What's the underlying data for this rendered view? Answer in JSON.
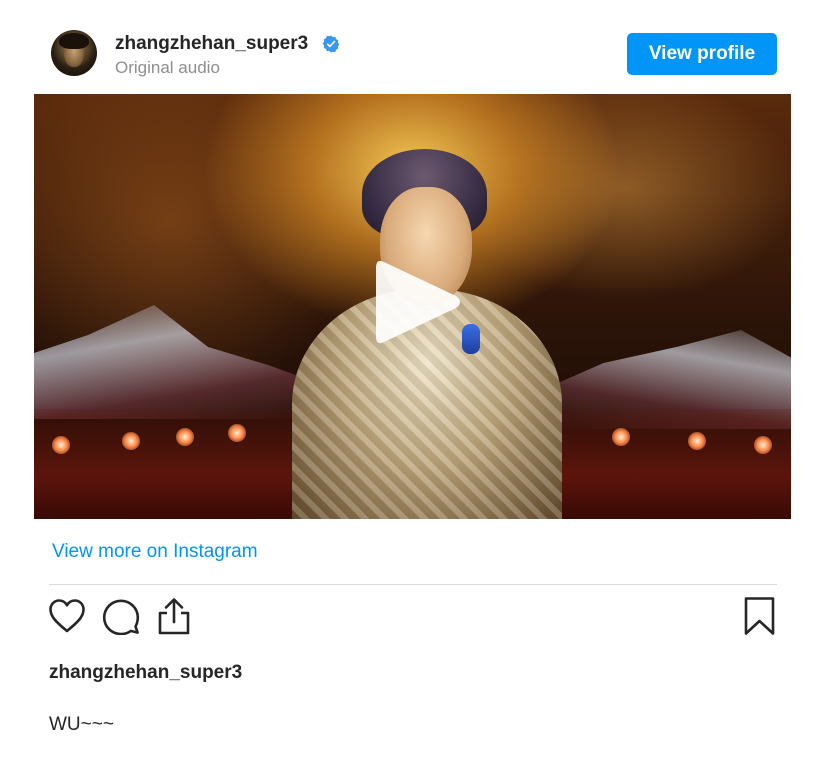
{
  "header": {
    "username": "zhangzhehan_super3",
    "subtitle": "Original audio",
    "verified": true,
    "view_profile_label": "View profile"
  },
  "media": {
    "type": "video",
    "play_icon": "play-icon"
  },
  "link": {
    "view_more_label": "View more on Instagram"
  },
  "actions": {
    "icons": [
      "heart-icon",
      "comment-icon",
      "share-icon",
      "bookmark-icon"
    ]
  },
  "caption": {
    "username": "zhangzhehan_super3",
    "text": "WU~~~"
  },
  "colors": {
    "accent": "#0095f6",
    "text": "#262626",
    "secondary_text": "#8e8e8e",
    "divider": "#dbdbdb"
  }
}
